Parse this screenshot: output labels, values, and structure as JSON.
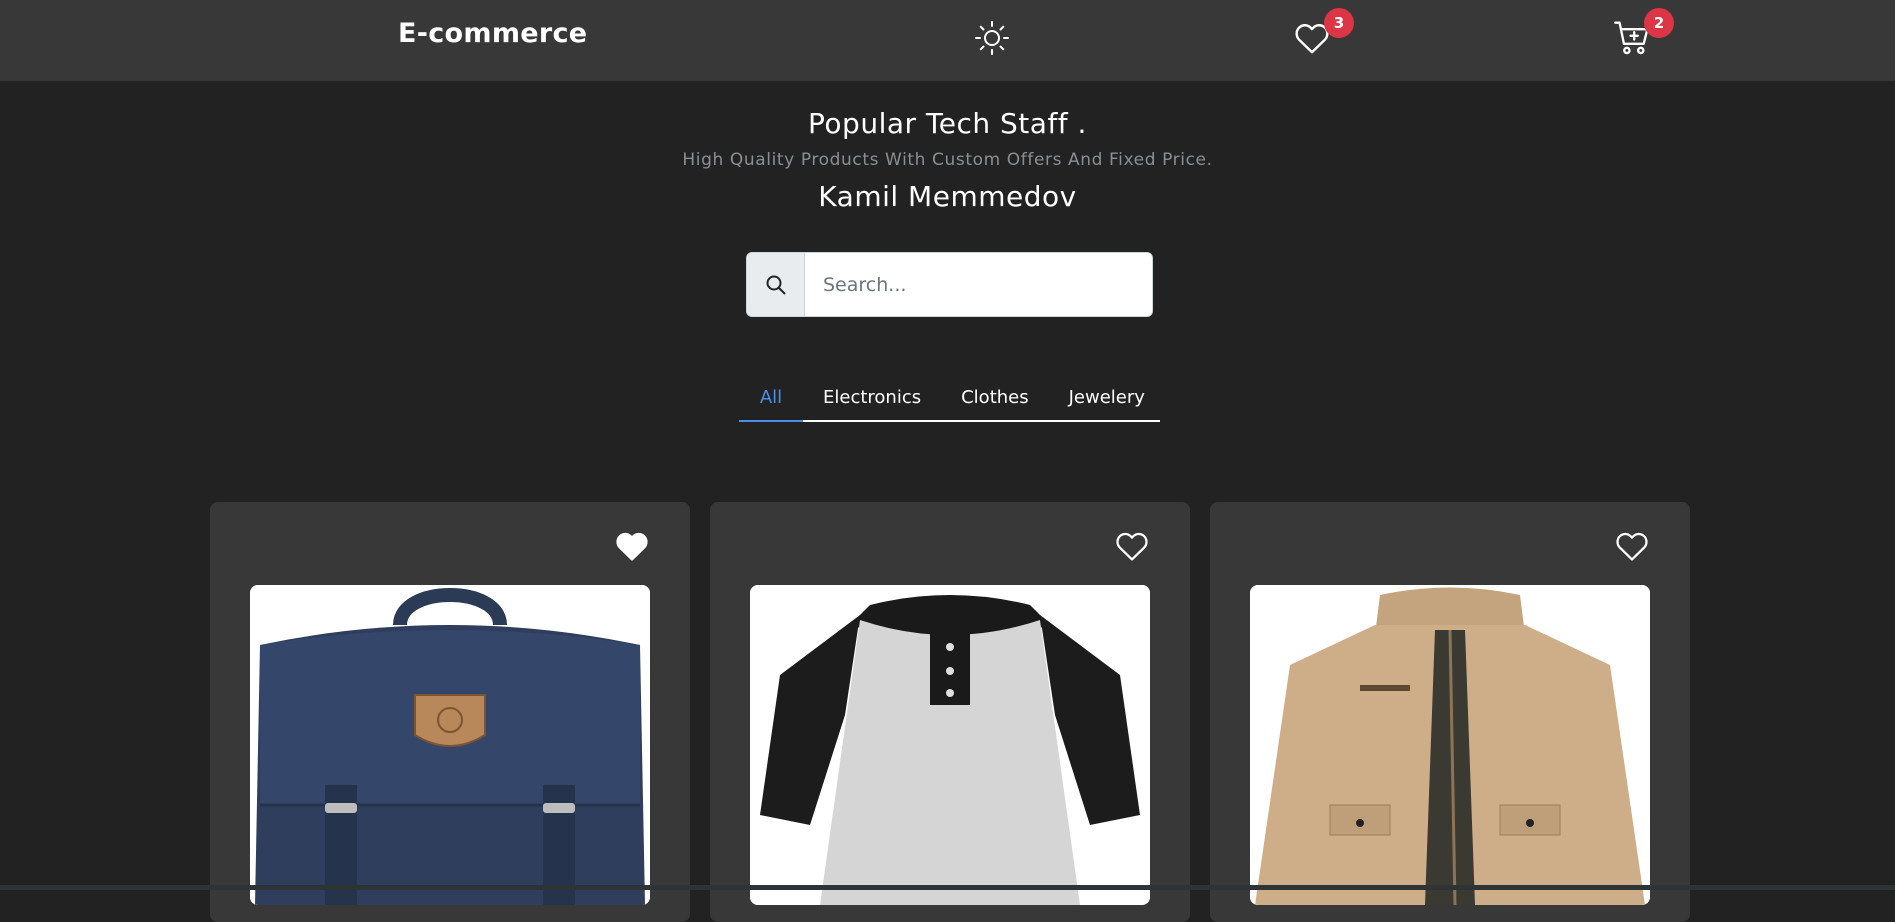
{
  "navbar": {
    "brand": "E-commerce",
    "theme_icon": "sun-icon",
    "wishlist_icon": "heart-icon",
    "wishlist_count": "3",
    "cart_icon": "cart-icon",
    "cart_count": "2"
  },
  "hero": {
    "title": "Popular Tech Staff .",
    "subtitle": "High Quality Products With Custom Offers And Fixed Price.",
    "author": "Kamil Memmedov"
  },
  "search": {
    "icon": "search-icon",
    "placeholder": "Search..."
  },
  "tabs": [
    {
      "label": "All",
      "active": true
    },
    {
      "label": "Electronics",
      "active": false
    },
    {
      "label": "Clothes",
      "active": false
    },
    {
      "label": "Jewelery",
      "active": false
    }
  ],
  "products": [
    {
      "product": "backpack",
      "favorited": true
    },
    {
      "product": "raglan t-shirt",
      "favorited": false
    },
    {
      "product": "jacket",
      "favorited": false
    }
  ],
  "colors": {
    "background": "#222222",
    "navbar": "#383838",
    "card": "#383838",
    "badge": "#dc3545",
    "active_tab": "#4d8ee8"
  }
}
